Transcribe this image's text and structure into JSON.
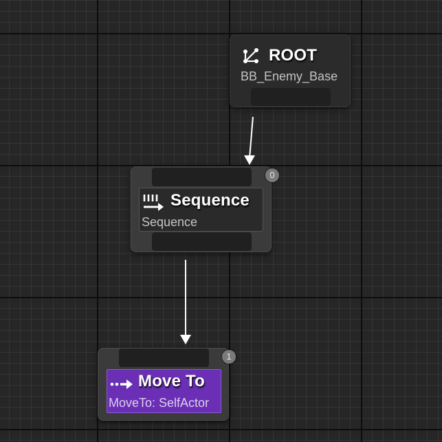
{
  "graph": {
    "nodes": {
      "root": {
        "title": "ROOT",
        "subtitle": "BB_Enemy_Base",
        "icon": "root-tree-icon"
      },
      "sequence": {
        "title": "Sequence",
        "subtitle": "Sequence",
        "icon": "sequence-icon",
        "execution_index": "0"
      },
      "move_to": {
        "title": "Move To",
        "subtitle": "MoveTo: SelfActor",
        "icon": "move-to-arrow-icon",
        "execution_index": "1",
        "accent_color": "#6a2fb4"
      }
    },
    "colors": {
      "background": "#262626",
      "node_body": "#3b3b3b",
      "task_node": "#6a2fb4",
      "wire": "#ffffff"
    }
  }
}
